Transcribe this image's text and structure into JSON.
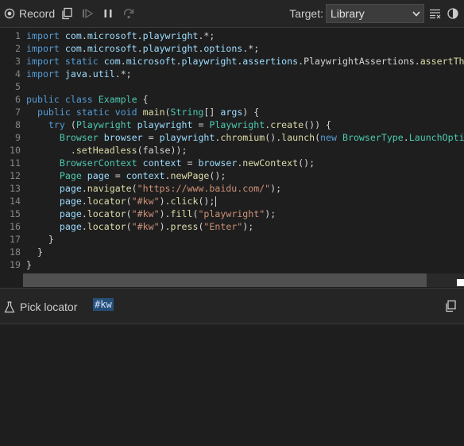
{
  "toolbar": {
    "record_label": "Record",
    "target_label": "Target:",
    "target_value": "Library",
    "icons": [
      "record-icon",
      "copy-icon",
      "resume-icon",
      "pause-icon",
      "step-over-icon",
      "clear-icon",
      "theme-icon"
    ]
  },
  "editor": {
    "lines": [
      {
        "n": "1",
        "text": "import com.microsoft.playwright.*;"
      },
      {
        "n": "2",
        "text": "import com.microsoft.playwright.options.*;"
      },
      {
        "n": "3",
        "text": "import static com.microsoft.playwright.assertions.PlaywrightAssertions.assertThat;"
      },
      {
        "n": "4",
        "text": "import java.util.*;"
      },
      {
        "n": "5",
        "text": ""
      },
      {
        "n": "6",
        "text": "public class Example {"
      },
      {
        "n": "7",
        "text": "  public static void main(String[] args) {"
      },
      {
        "n": "8",
        "text": "    try (Playwright playwright = Playwright.create()) {"
      },
      {
        "n": "9",
        "text": "      Browser browser = playwright.chromium().launch(new BrowserType.LaunchOptions()"
      },
      {
        "n": "10",
        "text": "        .setHeadless(false));"
      },
      {
        "n": "11",
        "text": "      BrowserContext context = browser.newContext();"
      },
      {
        "n": "12",
        "text": "      Page page = context.newPage();"
      },
      {
        "n": "13",
        "text": "      page.navigate(\"https://www.baidu.com/\");"
      },
      {
        "n": "14",
        "text": "      page.locator(\"#kw\").click();"
      },
      {
        "n": "15",
        "text": "      page.locator(\"#kw\").fill(\"playwright\");"
      },
      {
        "n": "16",
        "text": "      page.locator(\"#kw\").press(\"Enter\");"
      },
      {
        "n": "17",
        "text": "    }"
      },
      {
        "n": "18",
        "text": "  }"
      },
      {
        "n": "19",
        "text": "}"
      }
    ]
  },
  "bottom": {
    "pick_label": "Pick locator",
    "locator_value": "#kw"
  },
  "colors": {
    "keyword": "#569cd6",
    "type": "#4ec9b0",
    "method": "#dcdcaa",
    "string": "#ce9178",
    "variable": "#9cdcfe",
    "plain": "#d4d4d4",
    "selection": "#264f78"
  }
}
